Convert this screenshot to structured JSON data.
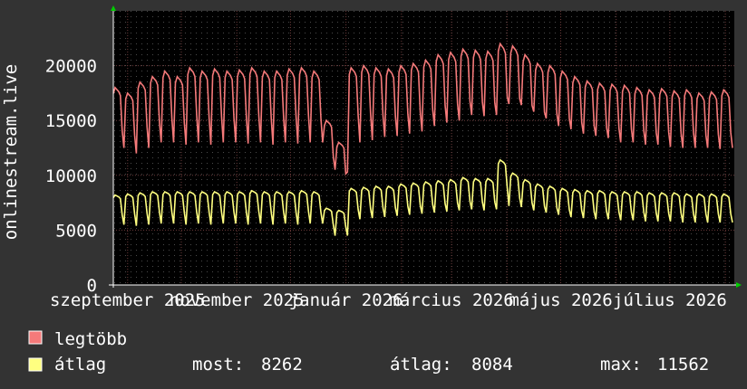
{
  "chart_data": {
    "type": "line",
    "ylabel": "onlinestream.live",
    "ylim": [
      0,
      25000
    ],
    "y_ticks": [
      "0",
      "5000",
      "10000",
      "15000",
      "20000"
    ],
    "y_tick_values": [
      0,
      5000,
      10000,
      15000,
      20000
    ],
    "x_range": [
      "2025-08-24",
      "2026-08-06"
    ],
    "x_ticks": [
      {
        "label": "szeptember 2025",
        "date": "2025-09-01"
      },
      {
        "label": "november 2025",
        "date": "2025-11-01"
      },
      {
        "label": "január 2026",
        "date": "2026-01-01"
      },
      {
        "label": "március 2026",
        "date": "2026-03-01"
      },
      {
        "label": "május 2026",
        "date": "2026-05-01"
      },
      {
        "label": "július 2026",
        "date": "2026-07-01"
      }
    ],
    "grid": true,
    "series": [
      {
        "name": "legtöbb",
        "color": "#F57A7A",
        "weekday_peak_by_week": [
          18000,
          17500,
          18500,
          19000,
          19500,
          19000,
          19800,
          19500,
          19700,
          19500,
          19600,
          19800,
          19500,
          19500,
          19700,
          19800,
          19500,
          15000,
          13000,
          19800,
          20000,
          19800,
          19700,
          20000,
          20200,
          20500,
          21000,
          21200,
          21500,
          21400,
          21300,
          22000,
          21800,
          21000,
          20200,
          20000,
          19500,
          19000,
          18600,
          18400,
          18300,
          18200,
          18000,
          17800,
          17900,
          17700,
          17800,
          17500,
          17600,
          17800
        ],
        "weekend_low_by_week": [
          12500,
          12000,
          12500,
          13000,
          13000,
          12800,
          13000,
          12800,
          13000,
          13000,
          12900,
          13000,
          12800,
          13000,
          12900,
          13000,
          13000,
          10500,
          10300,
          13000,
          13200,
          13500,
          13600,
          13800,
          14000,
          14500,
          14800,
          15000,
          15500,
          15400,
          15500,
          16500,
          16400,
          15800,
          15200,
          14500,
          14200,
          13800,
          13600,
          13400,
          13000,
          13000,
          12800,
          12800,
          12600,
          12500,
          12500,
          12500,
          12400,
          12500
        ]
      },
      {
        "name": "átlag",
        "color": "#FFFF80",
        "weekday_peak_by_week": [
          8200,
          8300,
          8400,
          8500,
          8500,
          8500,
          8500,
          8500,
          8500,
          8500,
          8500,
          8600,
          8500,
          8500,
          8500,
          8600,
          8500,
          7000,
          6800,
          8800,
          8900,
          9000,
          9000,
          9200,
          9300,
          9400,
          9500,
          9600,
          9800,
          9700,
          9700,
          11400,
          10200,
          9600,
          9200,
          9000,
          8800,
          8700,
          8600,
          8600,
          8500,
          8500,
          8500,
          8400,
          8400,
          8400,
          8300,
          8300,
          8300,
          8300
        ],
        "weekend_low_by_week": [
          5500,
          5400,
          5500,
          5600,
          5600,
          5500,
          5600,
          5500,
          5600,
          5600,
          5500,
          5600,
          5500,
          5600,
          5500,
          5600,
          5600,
          4500,
          4500,
          6000,
          6100,
          6200,
          6300,
          6400,
          6500,
          6600,
          6700,
          6800,
          6900,
          6800,
          6900,
          7200,
          7100,
          6800,
          6600,
          6400,
          6200,
          6100,
          6000,
          6000,
          5900,
          5900,
          5800,
          5800,
          5800,
          5700,
          5700,
          5700,
          5700,
          5700
        ]
      }
    ],
    "stats": {
      "most_label": "most:",
      "most_value": "8262",
      "atlag_label": "átlag:",
      "atlag_value": "8084",
      "max_label": "max:",
      "max_value": "11562"
    }
  }
}
